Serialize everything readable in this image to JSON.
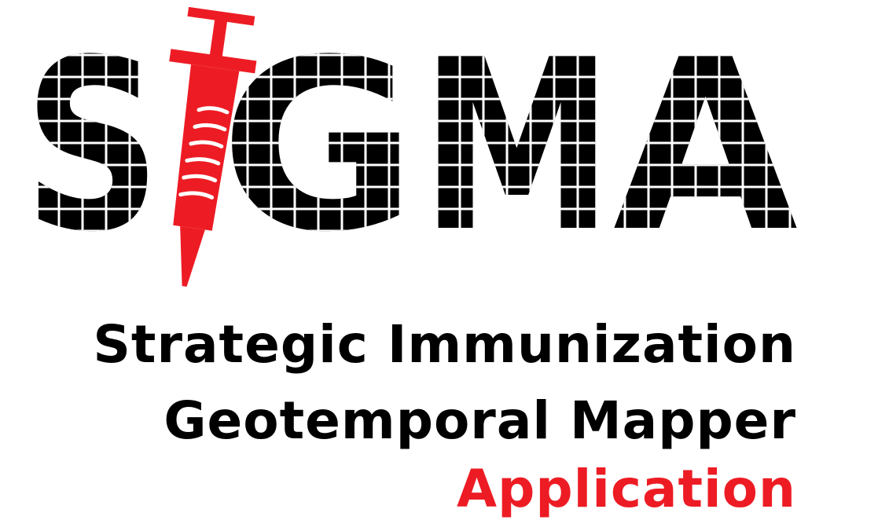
{
  "logo": {
    "wordmark": "SIGMA",
    "letters": [
      "S",
      "G",
      "M",
      "A"
    ],
    "i_replacement_icon": "syringe-icon",
    "letter_fill": "#000000",
    "grid_color": "#ffffff",
    "accent_color": "#ed1c24"
  },
  "tagline": {
    "line1": "Strategic Immunization",
    "line2": "Geotemporal Mapper",
    "line3": "Application"
  },
  "colors": {
    "text": "#000000",
    "accent": "#ed1c24",
    "background": "#ffffff"
  }
}
